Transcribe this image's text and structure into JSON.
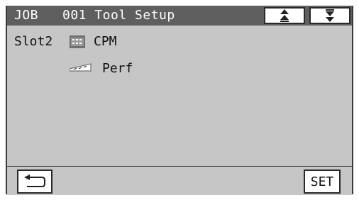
{
  "header": {
    "job_label": "JOB",
    "title": "001 Tool Setup",
    "scroll_up_icon": "double-up-arrow-icon",
    "scroll_down_icon": "double-down-arrow-icon"
  },
  "content": {
    "slot_label": "Slot2",
    "tools": [
      {
        "icon": "cpm-tool-icon",
        "label": "CPM"
      },
      {
        "icon": "perf-tool-icon",
        "label": "Perf"
      }
    ]
  },
  "footer": {
    "back_icon": "back-return-icon",
    "set_label": "SET"
  },
  "colors": {
    "header_bg": "#5f5f5f",
    "panel_bg": "#c6c6c6",
    "button_bg": "#ffffff"
  }
}
